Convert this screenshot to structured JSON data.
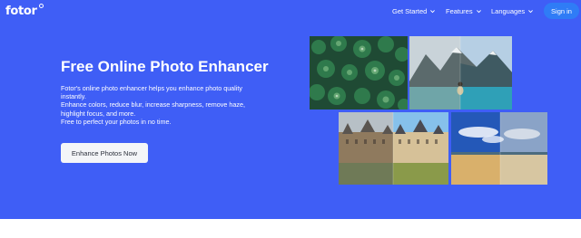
{
  "nav": {
    "logo": "fotor",
    "items": [
      {
        "label": "Get Started"
      },
      {
        "label": "Features"
      },
      {
        "label": "Languages"
      }
    ],
    "signin_label": "Sign in"
  },
  "hero": {
    "title": "Free Online Photo Enhancer",
    "description_lines": [
      "Fotor's online photo enhancer helps you enhance photo quality",
      "instantly.",
      "Enhance colors, reduce blur, increase sharpness, remove haze,",
      "highlight focus, and more.",
      "Free to perfect your photos in no time."
    ],
    "cta_label": "Enhance Photos Now"
  },
  "images": [
    {
      "name": "pine-trees-aerial-photo",
      "subject": "aerial view of pine forest"
    },
    {
      "name": "mountain-lake-photo",
      "subject": "person at mountain lake, before/after split"
    },
    {
      "name": "castle-photo",
      "subject": "castle, before/after split"
    },
    {
      "name": "desert-sky-photo",
      "subject": "desert under blue sky, before/after split"
    }
  ],
  "colors": {
    "hero_bg": "#3f5ef6",
    "signin_bg": "#2f7cf6",
    "cta_bg": "#f4f5f8"
  }
}
